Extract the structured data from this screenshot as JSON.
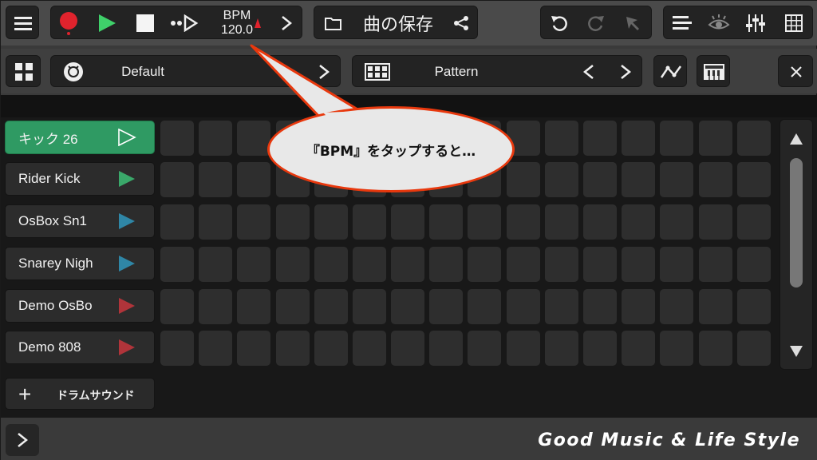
{
  "transport": {
    "bpm_label": "BPM",
    "bpm_value": "120.0"
  },
  "song": {
    "title": "曲の保存"
  },
  "kit": {
    "name": "Default"
  },
  "pattern": {
    "name": "Pattern"
  },
  "tracks": [
    {
      "name": "キック 26",
      "play_color": "#2f9a63",
      "active": true
    },
    {
      "name": "Rider Kick",
      "play_color": "#3aa86a",
      "active": false
    },
    {
      "name": "OsBox Sn1",
      "play_color": "#2f86a6",
      "active": false
    },
    {
      "name": "Snarey Nigh",
      "play_color": "#2f86a6",
      "active": false
    },
    {
      "name": "Demo OsBo",
      "play_color": "#b0343a",
      "active": false
    },
    {
      "name": "Demo 808",
      "play_color": "#b0343a",
      "active": false
    }
  ],
  "add_sound": {
    "label": "ドラムサウンド"
  },
  "callout": {
    "text": "『BPM』をタップすると…"
  },
  "watermark": "Good Music & Life Style",
  "colors": {
    "record": "#e0232d",
    "play": "#3fd06a",
    "active_track": "#2f9a63",
    "callout_border": "#e8380d"
  },
  "icons": [
    "menu-icon",
    "record-icon",
    "play-icon",
    "stop-icon",
    "count-in-icon",
    "chevron-right-icon",
    "folder-icon",
    "share-icon",
    "undo-icon",
    "redo-icon",
    "pointer-icon",
    "list-icon",
    "eye-icon",
    "mixer-icon",
    "grid-icon",
    "apps-icon",
    "drum-icon",
    "pattern-grid-icon",
    "chevron-left-icon",
    "automation-icon",
    "keyboard-icon",
    "close-icon",
    "arrow-up-icon",
    "arrow-down-icon",
    "plus-icon"
  ]
}
